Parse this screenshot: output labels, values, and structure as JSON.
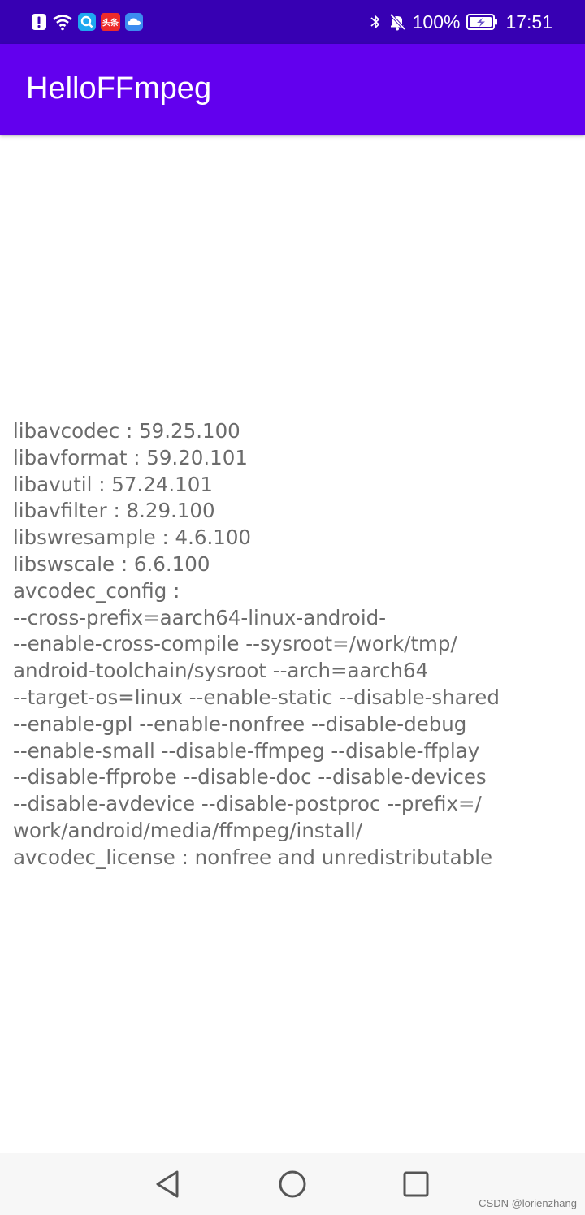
{
  "status_bar": {
    "battery_percent": "100%",
    "time": "17:51",
    "icons": [
      "alert-icon",
      "wifi-icon",
      "search-app-icon",
      "toutiao-app-icon",
      "cloud-app-icon",
      "bluetooth-icon",
      "mute-bell-icon",
      "battery-charging-icon"
    ],
    "toutiao_label": "头条",
    "colors": {
      "background": "#3700b3",
      "text": "#ffffff"
    }
  },
  "toolbar": {
    "title": "HelloFFmpeg",
    "colors": {
      "background": "#6200ee",
      "text": "#ffffff"
    }
  },
  "content": {
    "lines": [
      "libavcodec : 59.25.100",
      "libavformat : 59.20.101",
      "libavutil : 57.24.101",
      "libavfilter : 8.29.100",
      "libswresample : 4.6.100",
      "libswscale : 6.6.100",
      "avcodec_config :",
      "--cross-prefix=aarch64-linux-android-",
      "--enable-cross-compile --sysroot=/work/tmp/",
      "android-toolchain/sysroot --arch=aarch64",
      "--target-os=linux --enable-static --disable-shared",
      "--enable-gpl --enable-nonfree --disable-debug",
      "--enable-small --disable-ffmpeg --disable-ffplay",
      "--disable-ffprobe --disable-doc --disable-devices",
      "--disable-avdevice --disable-postproc --prefix=/",
      "work/android/media/ffmpeg/install/",
      "avcodec_license : nonfree and unredistributable"
    ],
    "colors": {
      "text": "#6b6b6b"
    }
  },
  "nav_bar": {
    "icons": [
      "back-triangle-icon",
      "home-circle-icon",
      "recents-square-icon"
    ]
  },
  "watermark": "CSDN @lorienzhang"
}
